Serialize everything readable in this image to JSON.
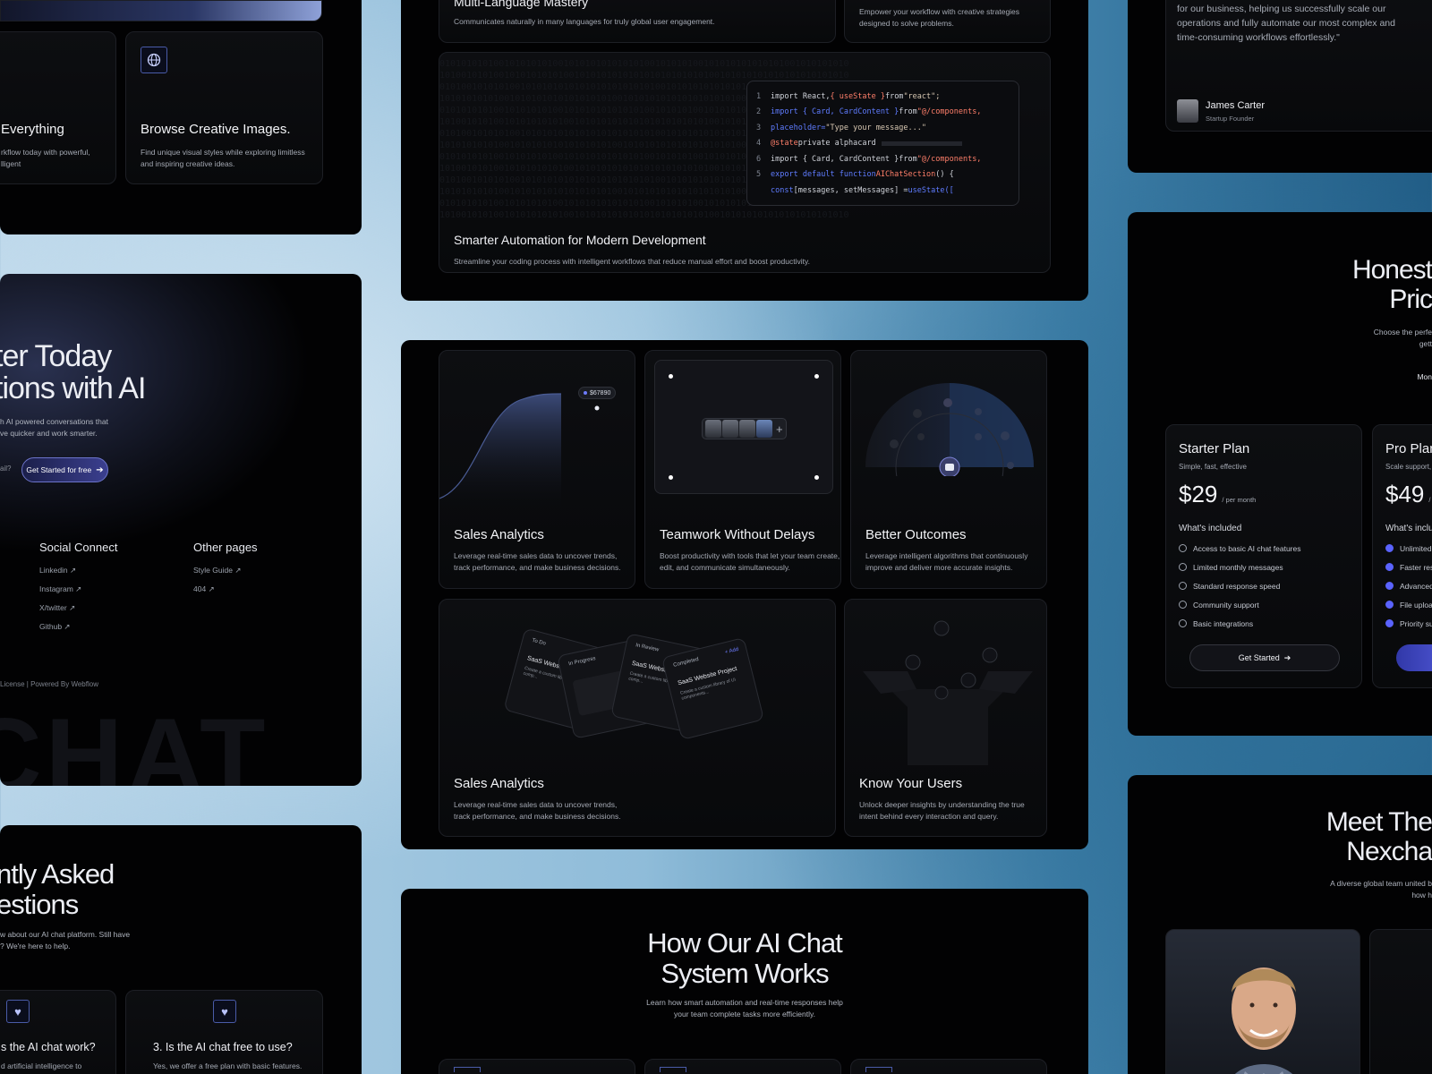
{
  "colors": {
    "accent": "#5a63ff",
    "panel_bg": "#020203",
    "card_bg": "#0b0c0f",
    "sky_light": "#cfe3f1",
    "sky_dark": "#1f5a83"
  },
  "left_top": {
    "card_a": {
      "title": "Everything",
      "desc_1": "rkflow today with powerful,",
      "desc_2": "lligent"
    },
    "card_b": {
      "title": "Browse Creative Images.",
      "desc_1": "Find unique visual styles while exploring limitless",
      "desc_2": "and inspiring creative ideas.",
      "icon": "globe-icon"
    }
  },
  "left_cta": {
    "title_1": "ter Today",
    "title_2": "tions with AI",
    "desc_1": "h AI powered conversations that",
    "desc_2": "ve quicker and work smarter.",
    "input_tail": "ail?",
    "button_label": "Get Started for free",
    "social": {
      "heading": "Social Connect",
      "links": [
        "Linkedin",
        "Instagram",
        "X/twitter",
        "Github"
      ]
    },
    "other": {
      "heading": "Other pages",
      "links": [
        "Style Guide",
        "404"
      ]
    },
    "footer": "License | Powered By Webflow",
    "watermark": "CHAT"
  },
  "left_faq": {
    "title_1": "ntly Asked",
    "title_2": "estions",
    "desc_1": "w about our AI chat platform. Still have",
    "desc_2": "? We're here to help.",
    "q1": {
      "title": "s the AI chat work?",
      "desc": "d artificial intelligence to"
    },
    "q2": {
      "title": "3. Is the AI chat free to use?",
      "desc": "Yes, we offer a free plan with basic features."
    }
  },
  "center_top": {
    "card_lang": {
      "title": "Multi-Language Mastery",
      "desc": "Communicates naturally in many languages for truly global user engagement."
    },
    "card_creative": {
      "desc_1": "Empower your workflow with creative strategies",
      "desc_2": "designed to solve problems."
    },
    "code_card": {
      "title": "Smarter Automation for Modern Development",
      "desc": "Streamline your coding process with intelligent workflows that reduce manual effort and boost productivity.",
      "lines": [
        {
          "n": "1",
          "a": "import React, ",
          "b": "{ useState }",
          "c": " from ",
          "d": "\"react\";"
        },
        {
          "n": "2",
          "a": "  import { Card, CardContent }",
          "b": "",
          "c": " from ",
          "d": "\"@/components,"
        },
        {
          "n": "3",
          "a": "        placeholder=",
          "b": "",
          "c": "",
          "d": "\"Type your message...\""
        },
        {
          "n": "4",
          "a": "    @state",
          "b": "",
          "c": " private alphacard",
          "d": ""
        },
        {
          "n": "6",
          "a": "  import { Card, CardContent }",
          "b": "",
          "c": " from ",
          "d": "\"@/components,"
        },
        {
          "n": "5",
          "a": "export default function ",
          "b": "AIChatSection",
          "c": "() {",
          "d": ""
        },
        {
          "n": "",
          "a": "      const ",
          "b": "",
          "c": "[messages, setMessages] = ",
          "d": "useState(["
        }
      ]
    }
  },
  "center_mid": {
    "sales": {
      "title": "Sales Analytics",
      "desc_1": "Leverage real-time sales data to uncover trends,",
      "desc_2": "track performance, and make business decisions.",
      "badge": "$67890"
    },
    "teamwork": {
      "title": "Teamwork Without Delays",
      "desc_1": "Boost productivity with tools that let your team create,",
      "desc_2": "edit, and communicate simultaneously."
    },
    "outcomes": {
      "title": "Better Outcomes",
      "desc_1": "Leverage intelligent algorithms that continuously",
      "desc_2": "improve and deliver more accurate insights."
    },
    "sales2": {
      "title": "Sales Analytics",
      "desc_1": "Leverage real-time sales data to uncover trends,",
      "desc_2": "track performance, and make business decisions.",
      "kanban": [
        {
          "tag": "To Do",
          "title": "SaaS Website Pr",
          "body": "Create a custom library of UI\ncomp..."
        },
        {
          "tag": "In Progress",
          "title": "",
          "body": ""
        },
        {
          "tag": "In Review",
          "title": "SaaS Website Pr",
          "body": "Create a custom library of UI\ncomp..."
        },
        {
          "tag": "Completed",
          "title": "SaaS Website Project",
          "body": "Create a custom library of UI\ncomponents...",
          "add": "+ Add"
        }
      ]
    },
    "users": {
      "title": "Know Your Users",
      "desc_1": "Unlock deeper insights by understanding the true",
      "desc_2": "intent behind every interaction and query."
    }
  },
  "center_bottom": {
    "title_1": "How Our AI Chat",
    "title_2": "System Works",
    "desc_1": "Learn how smart automation and real-time responses help",
    "desc_2": "your team complete tasks more efficiently."
  },
  "right_testimonial": {
    "quote_1": "for our business, helping us successfully scale our",
    "quote_2": "operations and fully automate our most complex and",
    "quote_3": "time-consuming workflows effortlessly.\"",
    "name": "James Carter",
    "role": "Startup Founder"
  },
  "right_pricing": {
    "title_1": "Honest",
    "title_2": "Pric",
    "desc_1": "Choose the perfe",
    "desc_2": "gett",
    "toggle": "Mon",
    "starter": {
      "name": "Starter Plan",
      "tagline": "Simple, fast, effective",
      "price": "$29",
      "per": "/ per month",
      "included": "What's included",
      "features": [
        "Access to basic AI chat features",
        "Limited monthly messages",
        "Standard response speed",
        "Community support",
        "Basic integrations"
      ],
      "cta": "Get Started"
    },
    "pro": {
      "name": "Pro Plan",
      "tagline": "Scale support, ",
      "price": "$49",
      "per": "/",
      "included": "What's inclu",
      "features": [
        "Unlimited A",
        "Faster resp",
        "Advanced",
        "File upload",
        "Priority sup"
      ]
    }
  },
  "right_team": {
    "title_1": "Meet The",
    "title_2": "Nexcha",
    "desc_1": "A diverse global team united b",
    "desc_2": "how h"
  }
}
